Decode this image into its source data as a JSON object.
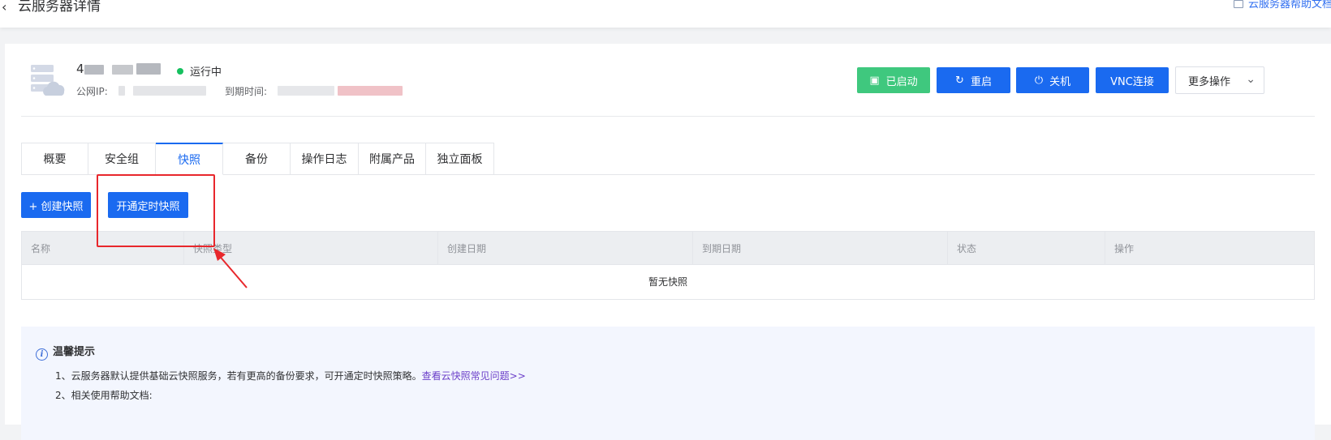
{
  "topbar": {
    "back_icon": "chevron-left-icon",
    "title": "云服务器详情",
    "help_icon": "document-icon",
    "help_link": "云服务器帮助文档"
  },
  "server": {
    "icon": "cloud-server-icon",
    "status": "运行中",
    "status_color": "#16c05f",
    "ip_label": "公网IP:",
    "expire_label": "到期时间:"
  },
  "actions": {
    "started": "已启动",
    "restart": "重启",
    "shutdown": "关机",
    "vnc": "VNC连接",
    "more": "更多操作"
  },
  "tabs": [
    "概要",
    "安全组",
    "快照",
    "备份",
    "操作日志",
    "附属产品",
    "独立面板"
  ],
  "active_tab": "快照",
  "toolbar": {
    "create_snapshot": "+ 创建快照",
    "enable_scheduled": "开通定时快照"
  },
  "table": {
    "columns": [
      "名称",
      "快照类型",
      "创建日期",
      "到期日期",
      "状态",
      "操作"
    ],
    "empty_text": "暂无快照"
  },
  "tips": {
    "title": "温馨提示",
    "line1": "1、云服务器默认提供基础云快照服务，若有更高的备份要求，可开通定时快照策略。",
    "line1_link": "查看云快照常见问题>>",
    "line2": "2、相关使用帮助文档:"
  },
  "colors": {
    "primary": "#1a6af0",
    "success": "#3fc87e",
    "annotation": "#e8272c"
  }
}
